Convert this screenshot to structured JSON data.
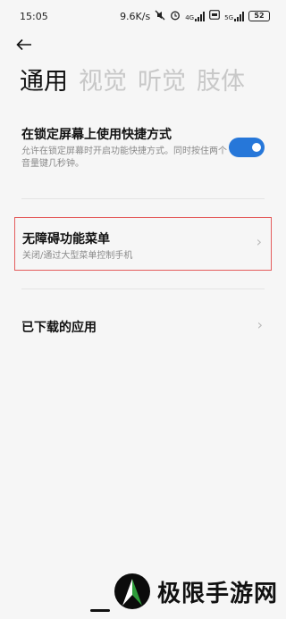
{
  "status_bar": {
    "time": "15:05",
    "net_speed": "9.6K/s",
    "sig1_label": "4G",
    "sig2_label": "5G",
    "battery": "52"
  },
  "tabs": [
    {
      "label": "通用"
    },
    {
      "label": "视觉"
    },
    {
      "label": "听觉"
    },
    {
      "label": "肢体"
    }
  ],
  "settings": {
    "lock_shortcut": {
      "title": "在锁定屏幕上使用快捷方式",
      "desc": "允许在锁定屏幕时开启功能快捷方式。同时按住两个音量键几秒钟。",
      "enabled": true
    },
    "a11y_menu": {
      "title": "无障碍功能菜单",
      "desc": "关闭/通过大型菜单控制手机"
    },
    "downloaded_apps": {
      "title": "已下载的应用"
    }
  },
  "watermark": {
    "text": "极限手游网"
  },
  "colors": {
    "accent": "#2677d9",
    "highlight_border": "#e45c5c",
    "logo_green": "#2e9d3a"
  }
}
